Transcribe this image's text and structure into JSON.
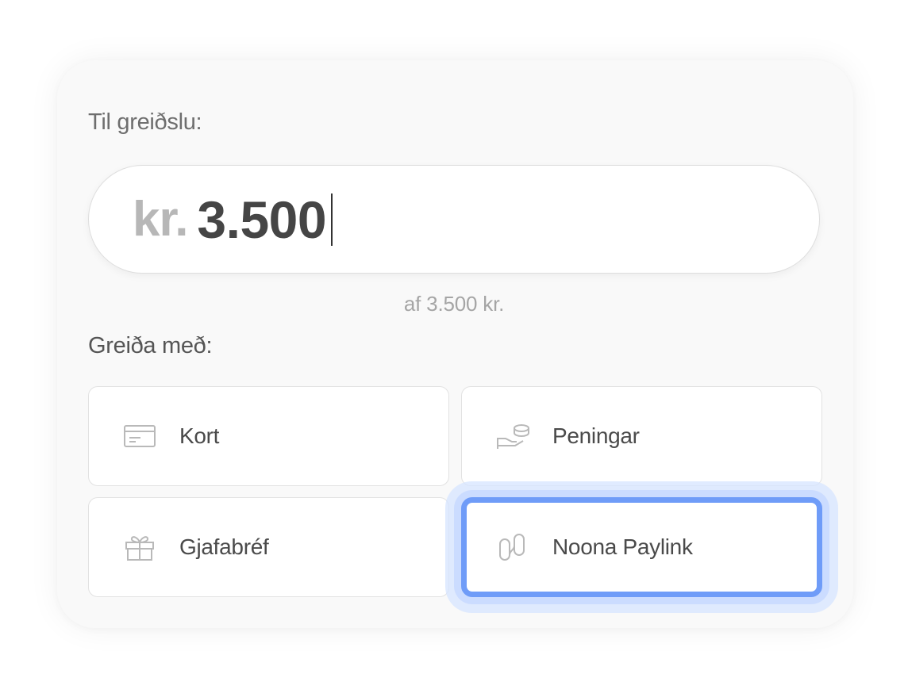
{
  "payment": {
    "to_pay_label": "Til greiðslu:",
    "currency_prefix": "kr.",
    "amount": "3.500",
    "of_total": "af 3.500 kr.",
    "pay_with_label": "Greiða með:",
    "selected_method": "Noona Paylink",
    "accent_color": "#6f9cf8"
  },
  "methods": [
    {
      "label": "Kort",
      "icon": "credit-card-icon"
    },
    {
      "label": "Peningar",
      "icon": "cash-icon"
    },
    {
      "label": "Gjafabréf",
      "icon": "gift-icon"
    },
    {
      "label": "Noona Paylink",
      "icon": "link-icon"
    }
  ]
}
